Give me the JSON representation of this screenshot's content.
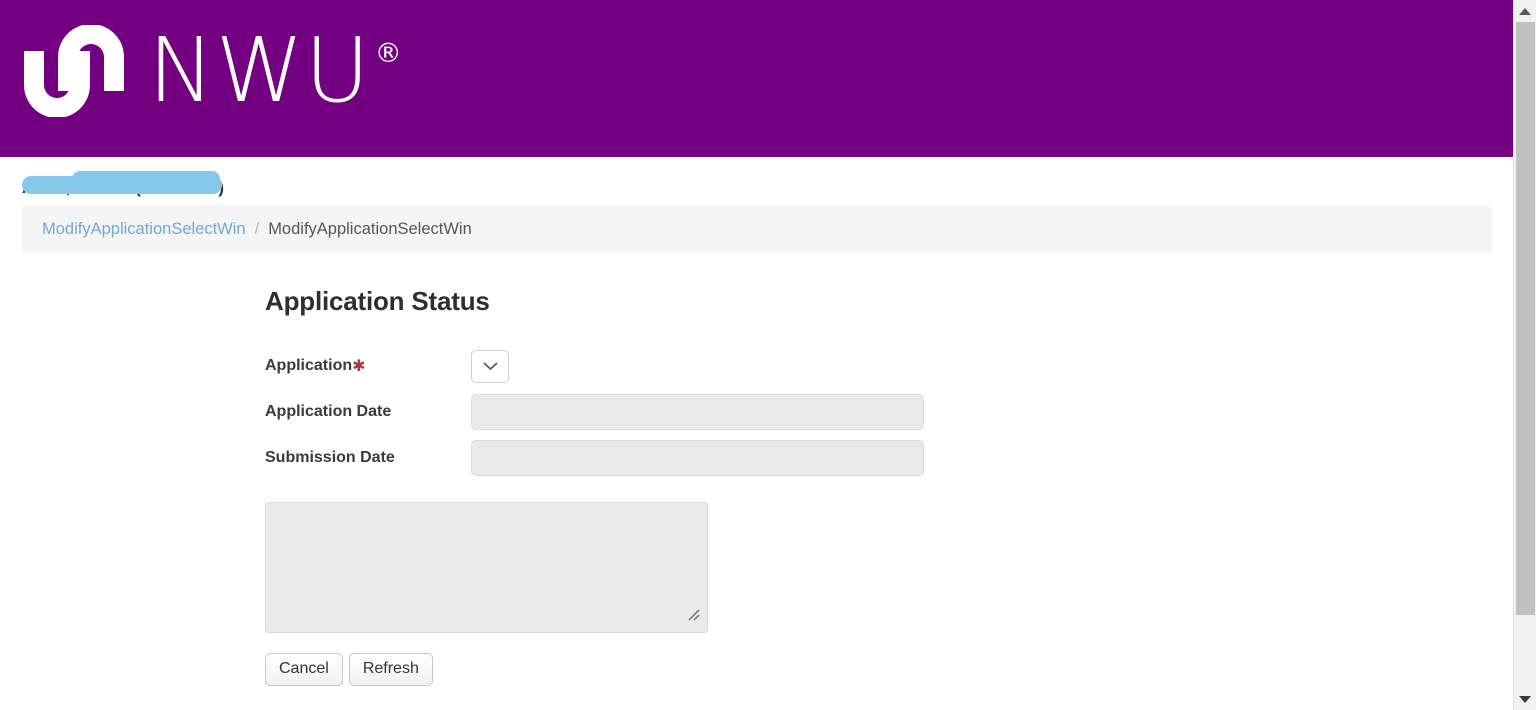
{
  "header": {
    "brand_name": "NWU",
    "brand_registered_symbol": "®",
    "logo_icon": "nwu-interlocking-logo-icon",
    "background_color": "#730080"
  },
  "user_line": {
    "text": "AS12, AS MR (12345678)",
    "redacted": true,
    "redaction_color": "#86c7ee"
  },
  "breadcrumb": {
    "link_label": "ModifyApplicationSelectWin",
    "separator": "/",
    "current_label": "ModifyApplicationSelectWin"
  },
  "main": {
    "title": "Application Status",
    "fields": [
      {
        "label": "Application",
        "required_marker": "✱",
        "type": "select",
        "value": "",
        "icon": "chevron-down-icon"
      },
      {
        "label": "Application Date",
        "required_marker": "",
        "type": "text",
        "value": "",
        "placeholder": "",
        "disabled": true
      },
      {
        "label": "Submission Date",
        "required_marker": "",
        "type": "text",
        "value": "",
        "placeholder": "",
        "disabled": true
      }
    ],
    "notes": {
      "value": "",
      "placeholder": "",
      "disabled": true,
      "resize_handle_icon": "resize-grip-icon"
    },
    "buttons": [
      {
        "label": "Cancel",
        "name": "cancel-button"
      },
      {
        "label": "Refresh",
        "name": "refresh-button"
      }
    ]
  },
  "scrollbar": {
    "up_icon": "scroll-up-arrow-icon",
    "down_icon": "scroll-down-arrow-icon",
    "thumb": "scrollbar-thumb"
  },
  "colors": {
    "brand_purple": "#730080",
    "breadcrumb_link": "#6fa8dc",
    "required_red": "#a93b3b",
    "disabled_field": "#eaeaea"
  }
}
